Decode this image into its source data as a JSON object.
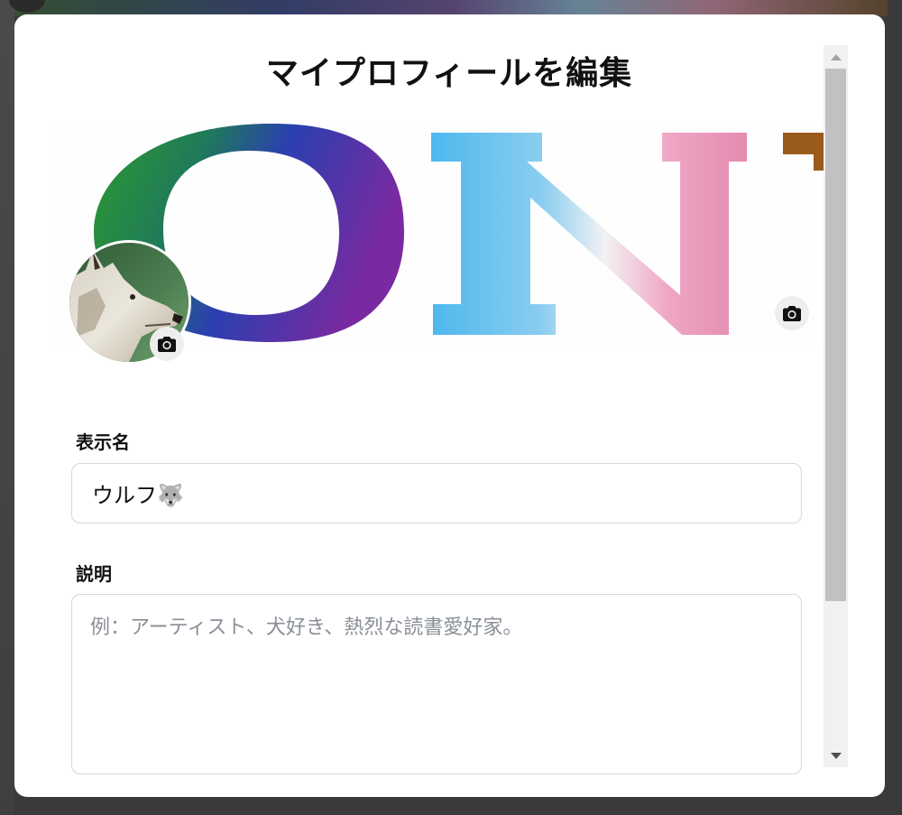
{
  "modal": {
    "title": "マイプロフィールを編集"
  },
  "banner": {
    "visible_letters": "ON"
  },
  "fields": {
    "display_name": {
      "label": "表示名",
      "value": "ウルフ🐺"
    },
    "description": {
      "label": "説明",
      "value": "",
      "placeholder": "例：アーティスト、犬好き、熱烈な読書愛好家。"
    }
  },
  "icons": {
    "banner_camera": "camera-icon",
    "avatar_camera": "camera-icon",
    "scroll_up": "triangle-up-icon",
    "scroll_down": "triangle-down-icon"
  }
}
